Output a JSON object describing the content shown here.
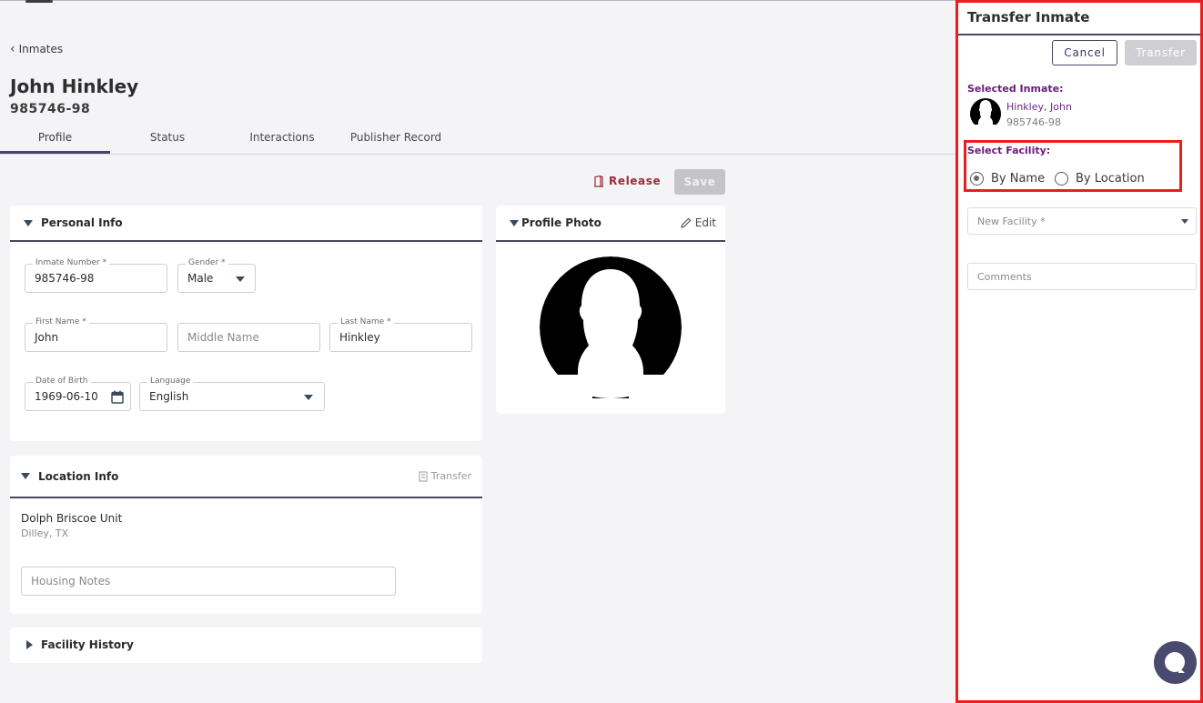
{
  "breadcrumb": {
    "back_label": "Inmates"
  },
  "header": {
    "title": "John Hinkley",
    "subtitle": "985746-98"
  },
  "tabs": [
    {
      "label": "Profile",
      "active": true
    },
    {
      "label": "Status"
    },
    {
      "label": "Interactions"
    },
    {
      "label": "Publisher Record"
    }
  ],
  "toolbar": {
    "release_label": "Release",
    "save_label": "Save"
  },
  "personal_info": {
    "title": "Personal Info",
    "inmate_number": {
      "label": "Inmate Number *",
      "value": "985746-98"
    },
    "gender": {
      "label": "Gender *",
      "value": "Male"
    },
    "first_name": {
      "label": "First Name *",
      "value": "John"
    },
    "middle_name": {
      "placeholder": "Middle Name"
    },
    "last_name": {
      "label": "Last Name *",
      "value": "Hinkley"
    },
    "dob": {
      "label": "Date of Birth",
      "value": "1969-06-10"
    },
    "language": {
      "label": "Language",
      "value": "English"
    }
  },
  "profile_photo": {
    "title": "Profile Photo",
    "edit_label": "Edit"
  },
  "location_info": {
    "title": "Location Info",
    "transfer_label": "Transfer",
    "facility_name": "Dolph Briscoe Unit",
    "facility_city": "Dilley, TX",
    "housing_notes_placeholder": "Housing Notes"
  },
  "facility_history": {
    "title": "Facility History"
  },
  "drawer": {
    "title": "Transfer Inmate",
    "cancel_label": "Cancel",
    "transfer_label": "Transfer",
    "selected_inmate_label": "Selected Inmate:",
    "inmate_name": "Hinkley, John",
    "inmate_number": "985746-98",
    "select_facility_label": "Select Facility:",
    "radio_by_name": "By Name",
    "radio_by_location": "By Location",
    "selected_mode": "By Name",
    "new_facility_placeholder": "New Facility *",
    "comments_placeholder": "Comments"
  },
  "colors": {
    "accent": "#4a4466",
    "danger": "#9a2b37",
    "highlight": "#ee1c1c",
    "inmate_purple": "#6a1a7a"
  },
  "icons": {
    "chat": "chat-bubble-icon",
    "calendar": "calendar-icon",
    "edit": "pencil-icon",
    "release": "door-icon"
  }
}
